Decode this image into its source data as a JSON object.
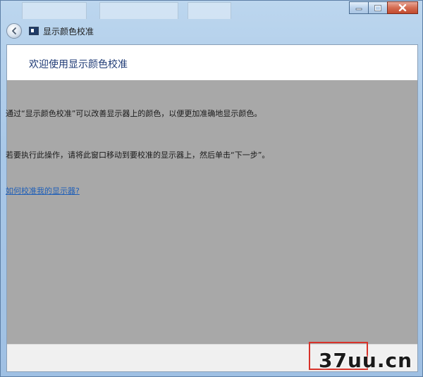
{
  "window": {
    "title": "显示颜色校准",
    "caption_buttons": [
      "minimize-icon",
      "maximize-icon",
      "close-icon"
    ]
  },
  "header": {
    "title": "欢迎使用显示颜色校准"
  },
  "body": {
    "paragraph1": "通过“显示颜色校准”可以改善显示器上的颜色，以便更加准确地显示颜色。",
    "paragraph2": "若要执行此操作，请将此窗口移动到要校准的显示器上，然后单击“下一步”。",
    "help_link": "如何校准我的显示器?"
  },
  "watermark": "37uu.cn",
  "colors": {
    "content_bg": "#a8a8a8",
    "title_color": "#1e3a75",
    "link_color": "#1f5fb8",
    "highlight": "#d8322a"
  }
}
